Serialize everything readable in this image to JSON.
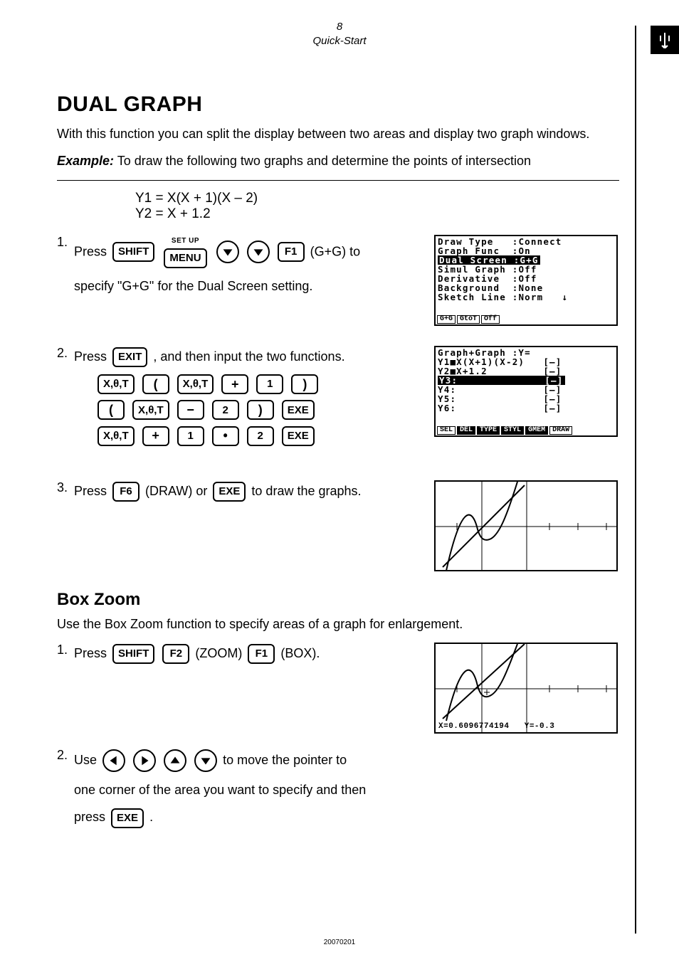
{
  "header": {
    "page_num": "8",
    "breadcrumb": "Quick-Start"
  },
  "section1": {
    "title": "DUAL GRAPH",
    "intro": "With this function you can split the display between two areas and display two graph windows.",
    "example_label": "Example:",
    "example_text": "To draw the following two graphs and determine the points of intersection",
    "eq1": "Y1 = X(X + 1)(X – 2)",
    "eq2": "Y2 = X + 1.2"
  },
  "step1": {
    "num": "1.",
    "press": "Press",
    "setup_label": "SET UP",
    "suffix": "(G+G) to",
    "line2": "specify \"G+G\" for the Dual Screen setting."
  },
  "lcd1": {
    "line1_a": "Draw Type",
    "line1_b": ":Connect",
    "line2_a": "Graph Func",
    "line2_b": ":On",
    "line3": "Dual Screen :G+G",
    "line4_a": "Simul Graph",
    "line4_b": ":Off",
    "line5_a": "Derivative",
    "line5_b": ":Off",
    "line6_a": "Background",
    "line6_b": ":None",
    "line7_a": "Sketch Line",
    "line7_b": ":Norm",
    "fk1": "G+G",
    "fk2": "GtoT",
    "fk3": "Off"
  },
  "step2": {
    "num": "2.",
    "press": "Press",
    "after": ", and then input the two functions."
  },
  "lcd2": {
    "line1": "Graph+Graph :Y=",
    "line2": "Y1■X(X+1)(X-2)   [—]",
    "line3": "Y2■X+1.2         [—]",
    "line4": "Y3:              [—]",
    "line5": "Y4:              [—]",
    "line6": "Y5:              [—]",
    "line7": "Y6:              [—]",
    "fk1": "SEL",
    "fk2": "DEL",
    "fk3": "TYPE",
    "fk4": "STYL",
    "fk5": "GMEM",
    "fk6": "DRAW"
  },
  "step3": {
    "num": "3.",
    "press": "Press",
    "mid": "(DRAW) or",
    "after": "to draw the graphs."
  },
  "section2": {
    "title": "Box Zoom",
    "intro": "Use the Box Zoom function to specify areas of a graph for enlargement."
  },
  "bz_step1": {
    "num": "1.",
    "press": "Press",
    "zoom": "(ZOOM)",
    "box": "(BOX)."
  },
  "bz_step2": {
    "num": "2.",
    "use": "Use",
    "after1": "to move the pointer to",
    "line2": "one corner of the area you want to specify and then",
    "line3a": "press",
    "line3b": "."
  },
  "lcd_coord": {
    "x": "X=0.6096774194",
    "y": "Y=-0.3"
  },
  "keys": {
    "shift": "SHIFT",
    "menu": "MENU",
    "f1": "F1",
    "f2": "F2",
    "f6": "F6",
    "exit": "EXIT",
    "exe": "EXE",
    "xthetat": "X,θ,T",
    "lparen": "(",
    "rparen": ")",
    "plus": "+",
    "minus": "−",
    "dot": "•",
    "d1": "1",
    "d2": "2"
  },
  "footer": "20070201"
}
